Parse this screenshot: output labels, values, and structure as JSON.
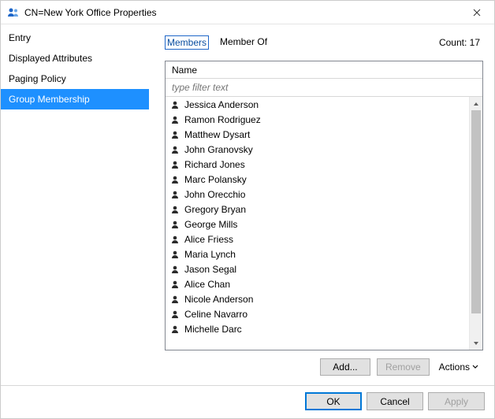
{
  "title": "CN=New York Office Properties",
  "sidebar": {
    "items": [
      {
        "label": "Entry"
      },
      {
        "label": "Displayed Attributes"
      },
      {
        "label": "Paging Policy"
      },
      {
        "label": "Group Membership"
      }
    ],
    "selected_index": 3
  },
  "tabs": {
    "members": "Members",
    "member_of": "Member Of",
    "active": "members"
  },
  "count_label": "Count: 17",
  "list": {
    "header": "Name",
    "filter_placeholder": "type filter text",
    "rows": [
      "Jessica Anderson",
      "Ramon Rodriguez",
      "Matthew Dysart",
      "John Granovsky",
      "Richard Jones",
      "Marc Polansky",
      "John Orecchio",
      "Gregory Bryan",
      "George Mills",
      "Alice Friess",
      "Maria Lynch",
      "Jason Segal",
      "Alice Chan",
      "Nicole Anderson",
      "Celine Navarro",
      "Michelle Darc"
    ]
  },
  "buttons": {
    "add": "Add...",
    "remove": "Remove",
    "actions": "Actions",
    "ok": "OK",
    "cancel": "Cancel",
    "apply": "Apply"
  }
}
